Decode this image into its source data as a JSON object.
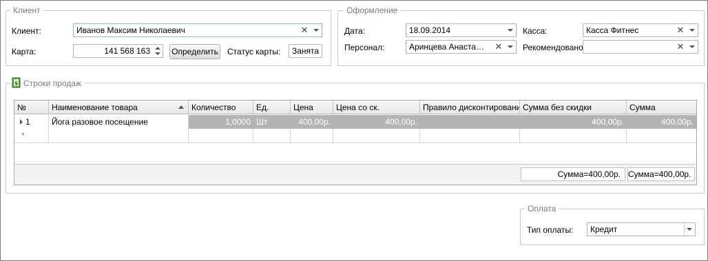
{
  "client_group": {
    "legend": "Клиент",
    "client_label": "Клиент:",
    "client_value": "Иванов Максим Николаевич",
    "card_label": "Карта:",
    "card_value": "141 568 163",
    "determine_button": "Определить",
    "card_status_label": "Статус карты:",
    "card_status_value": "Занята"
  },
  "registration_group": {
    "legend": "Оформление",
    "date_label": "Дата:",
    "date_value": "18.09.2014",
    "cashbox_label": "Касса:",
    "cashbox_value": "Касса Фитнес",
    "staff_label": "Персонал:",
    "staff_value": "Аринцева Анастасия ...",
    "recommended_label": "Рекомендовано:",
    "recommended_value": ""
  },
  "sales_group": {
    "legend": "Строки продаж",
    "icon": "money-document-icon",
    "columns": [
      "№",
      "Наименование товара",
      "Количество",
      "Ед.",
      "Цена",
      "Цена со ск.",
      "Правило дисконтирования",
      "Сумма без скидки",
      "Сумма"
    ],
    "rows": [
      {
        "num": "1",
        "name": "Йога разовое посещение",
        "qty": "1,0000",
        "unit": "Шт",
        "price": "400,00р.",
        "price_disc": "400,00р.",
        "rule": "",
        "sum_no_disc": "400,00р.",
        "sum": "400,00р."
      }
    ],
    "new_row_marker": "*",
    "footer_sum_no_disc": "Сумма=400,00р.",
    "footer_sum": "Сумма=400,00р."
  },
  "payment_group": {
    "legend": "Оплата",
    "type_label": "Тип оплаты:",
    "type_value": "Кредит"
  },
  "colors": {
    "selected_row": "#b4b4b4",
    "focus_border": "#8eb6e5",
    "group_border": "#c8c8c8",
    "legend_text": "#7a7a7a"
  }
}
